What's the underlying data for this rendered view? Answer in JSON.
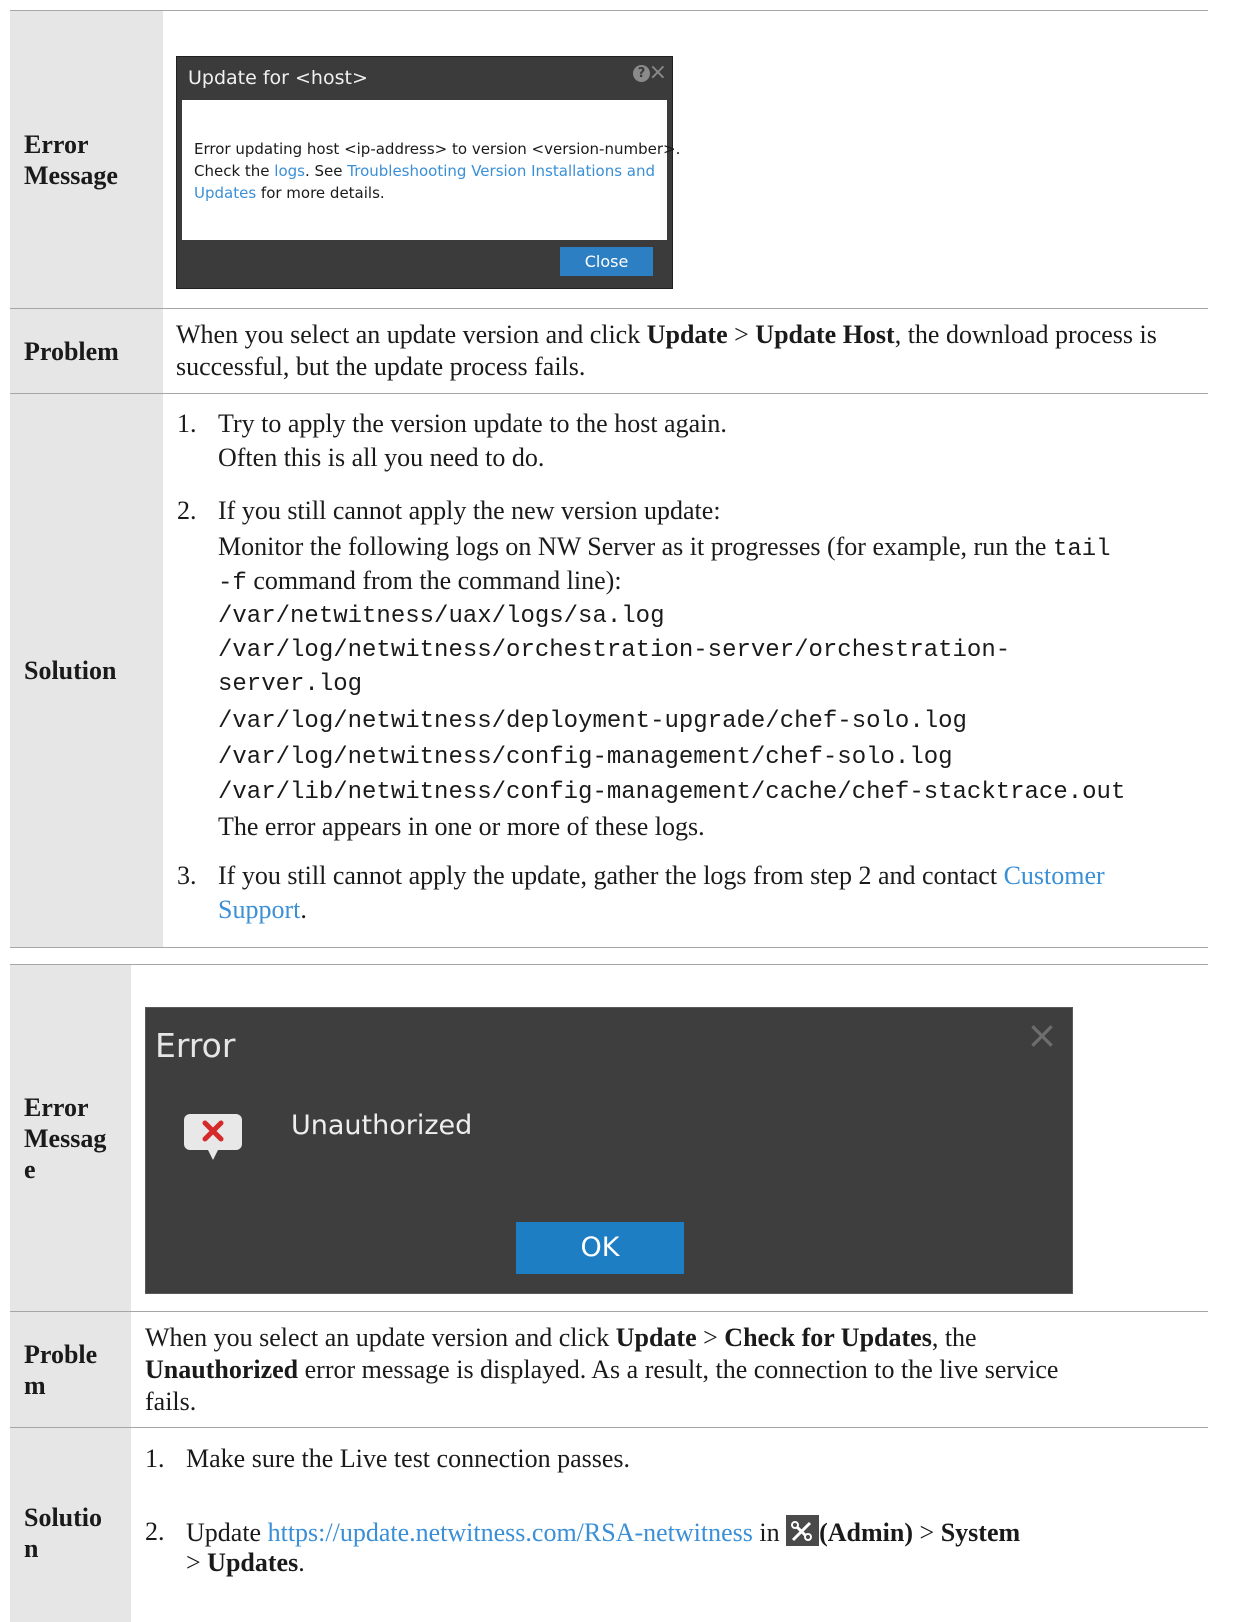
{
  "table1": {
    "row1": {
      "label": "Error Message",
      "dialog": {
        "title": "Update for <host>",
        "help_icon": "?",
        "close_icon": "×",
        "text_a": "Error updating host <ip-address> to version <version-number>.",
        "text_b1": "Check the ",
        "link_logs": "logs",
        "text_b2": ".  See ",
        "link_troubleshooting": "Troubleshooting Version Installations and Updates",
        "text_b3": " for more details.",
        "close_button": "Close"
      }
    },
    "row2": {
      "label": "Problem",
      "t1": "When you select an update version and click ",
      "b1": "Update",
      "t2": " > ",
      "b2": "Update Host",
      "t3": ", the download process is successful, but the update process fails."
    },
    "row3": {
      "label": "Solution",
      "step1": {
        "num": "1.",
        "line1": "Try to apply the version update to the host again.",
        "line2": "Often this is all you need to do."
      },
      "step2": {
        "num": "2.",
        "line1": "If you still cannot apply the new version update:",
        "line2a": "Monitor the following logs on NW Server as it progresses (for example, run the ",
        "code_a": "tail",
        "code_b": "-f",
        "line2b": " command from the command line):",
        "paths": [
          "/var/netwitness/uax/logs/sa.log",
          "/var/log/netwitness/orchestration-server/orchestration-",
          "server.log",
          "/var/log/netwitness/deployment-upgrade/chef-solo.log",
          "/var/log/netwitness/config-management/chef-solo.log",
          "/var/lib/netwitness/config-management/cache/chef-stacktrace.out"
        ],
        "line3": "The error appears in one or more of these logs."
      },
      "step3": {
        "num": "3.",
        "t1": "If you still cannot apply the update, gather the logs from step 2 and contact ",
        "link1": "Customer",
        "link2": "Support",
        "t2": "."
      }
    }
  },
  "table2": {
    "row1": {
      "label_l1": "Error",
      "label_l2": "Messag",
      "label_l3": "e",
      "dialog": {
        "title": "Error",
        "close_icon": "×",
        "message": "Unauthorized",
        "ok_button": "OK"
      }
    },
    "row2": {
      "label_l1": "Proble",
      "label_l2": "m",
      "t1": "When you select an update version and click ",
      "b1": "Update",
      "t2": " > ",
      "b2": "Check for Updates",
      "t3": ", the",
      "b3": "Unauthorized",
      "t4": " error message is displayed. As a result, the connection to the live service",
      "t5": "fails."
    },
    "row3": {
      "label_l1": "Solutio",
      "label_l2": "n",
      "step1": {
        "num": "1.",
        "text": "Make sure the Live test connection passes."
      },
      "step2": {
        "num": "2.",
        "t1": "Update ",
        "link": "https://update.netwitness.com/RSA-netwitness",
        "t2": " in ",
        "b1": "(Admin)",
        "t3": " > ",
        "b2": "System",
        "t4": "> ",
        "b3": "Updates",
        "t5": "."
      }
    }
  },
  "colors": {
    "label_bg": "#e6e6e6",
    "link": "#3a8fd6",
    "button_blue": "#2c7fc3"
  }
}
